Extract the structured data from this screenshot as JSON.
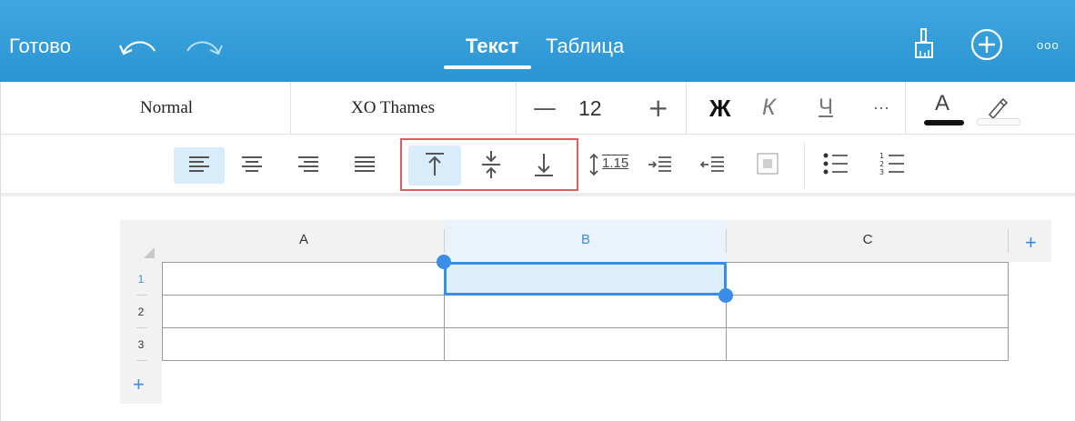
{
  "topbar": {
    "done_label": "Готово",
    "tabs": [
      {
        "label": "Текст",
        "active": true
      },
      {
        "label": "Таблица",
        "active": false
      }
    ],
    "more_label": "ooo",
    "icons": [
      "undo-icon",
      "redo-icon",
      "brush-icon",
      "add-circle-icon",
      "more-icon"
    ],
    "color": "#2b95d3"
  },
  "format_row": {
    "style_label": "Normal",
    "font_label": "XO Thames",
    "font_size": "12",
    "decrease_label": "—",
    "increase_label": "+",
    "bold_label": "Ж",
    "italic_label": "К",
    "underline_label": "Ч",
    "more_label": "···",
    "font_color_label": "A",
    "font_color": "#111111"
  },
  "paragraph_row": {
    "line_spacing_label": "1.15",
    "icons": [
      "align-left-icon",
      "align-center-icon",
      "align-right-icon",
      "align-justify-icon",
      "valign-top-icon",
      "valign-middle-icon",
      "valign-bottom-icon",
      "line-spacing-icon",
      "indent-increase-icon",
      "indent-decrease-icon",
      "fill-icon",
      "bullet-list-icon",
      "numbered-list-icon"
    ],
    "active_alignment": "left",
    "active_valign": "top",
    "highlight_color": "#d9ecfa"
  },
  "table": {
    "columns": [
      "A",
      "B",
      "C"
    ],
    "rows": [
      "1",
      "2",
      "3"
    ],
    "selected_column": "B",
    "selected_cell": "B1",
    "add_column_label": "+",
    "add_row_label": "+",
    "accent_color": "#3a8ee6"
  }
}
